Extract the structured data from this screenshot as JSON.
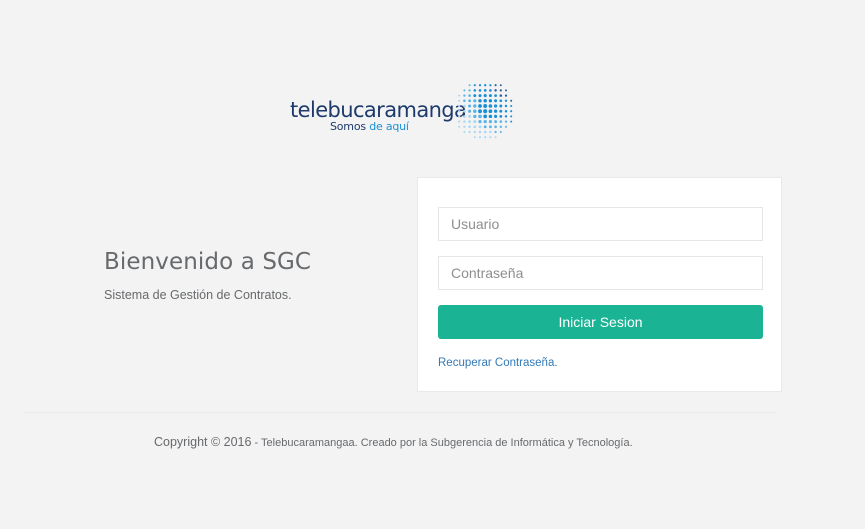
{
  "logo": {
    "wordmark": "telebucaramanga",
    "tagline_prefix": "Somos ",
    "tagline_accent": "de aquí"
  },
  "welcome": {
    "title": "Bienvenido a SGC",
    "subtitle": "Sistema de Gestión de Contratos."
  },
  "login": {
    "username_placeholder": "Usuario",
    "password_placeholder": "Contraseña",
    "submit_label": "Iniciar Sesion",
    "recover_link": "Recuperar Contraseña."
  },
  "footer": {
    "copyright_main": "Copyright © 2016",
    "copyright_rest": " - Telebucaramangaa. Creado por la Subgerencia de Informática y Tecnología."
  },
  "colors": {
    "background": "#f3f3f4",
    "primary_button": "#1ab394",
    "link": "#337ab7",
    "brand_navy": "#1d3a6b",
    "brand_blue": "#1a8fd4"
  }
}
